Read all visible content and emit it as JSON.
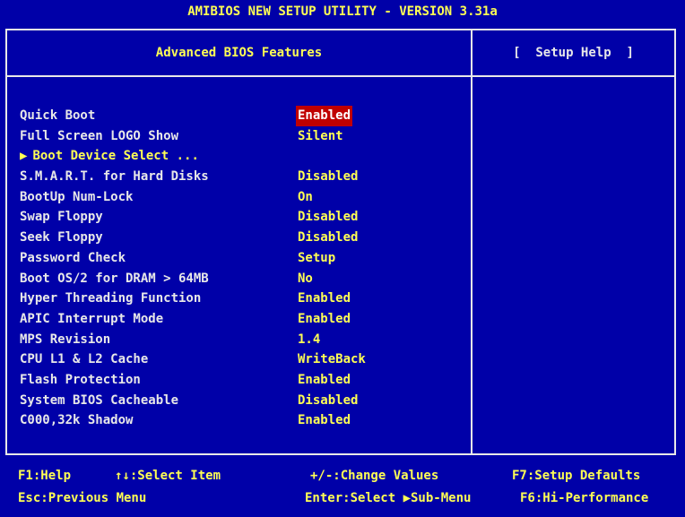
{
  "window": {
    "title": "AMIBIOS NEW SETUP UTILITY - VERSION 3.31a"
  },
  "panel": {
    "title": "Advanced BIOS Features",
    "help_title": "[  Setup Help  ]"
  },
  "settings": [
    {
      "label": "Quick Boot",
      "value": "Enabled",
      "selected": true
    },
    {
      "label": "Full Screen LOGO Show",
      "value": "Silent"
    },
    {
      "label": "Boot Device Select ...",
      "value": "",
      "submenu": true
    },
    {
      "label": "S.M.A.R.T. for Hard Disks",
      "value": "Disabled"
    },
    {
      "label": "BootUp Num-Lock",
      "value": "On"
    },
    {
      "label": "Swap Floppy",
      "value": "Disabled"
    },
    {
      "label": "Seek Floppy",
      "value": "Disabled"
    },
    {
      "label": "Password Check",
      "value": "Setup"
    },
    {
      "label": "Boot OS/2 for DRAM > 64MB",
      "value": "No"
    },
    {
      "label": "Hyper Threading Function",
      "value": "Enabled"
    },
    {
      "label": "APIC Interrupt Mode",
      "value": "Enabled"
    },
    {
      "label": "MPS Revision",
      "value": "1.4"
    },
    {
      "label": "CPU L1 & L2 Cache",
      "value": "WriteBack"
    },
    {
      "label": "Flash Protection",
      "value": "Enabled"
    },
    {
      "label": "System BIOS Cacheable",
      "value": "Disabled"
    },
    {
      "label": "C000,32k Shadow",
      "value": "Enabled"
    }
  ],
  "footer": {
    "help": "F1:Help",
    "select_item": "↑↓:Select Item",
    "change_values": "+/-:Change Values",
    "setup_defaults": "F7:Setup Defaults",
    "previous_menu": "Esc:Previous Menu",
    "select_submenu": "Enter:Select ▶Sub-Menu",
    "hi_performance": "F6:Hi-Performance"
  },
  "colors": {
    "background": "#0000a8",
    "highlight": "#ffff54",
    "selection": "#c00000",
    "text": "#e8e8e8"
  },
  "icons": {
    "submenu_marker": "▶"
  }
}
